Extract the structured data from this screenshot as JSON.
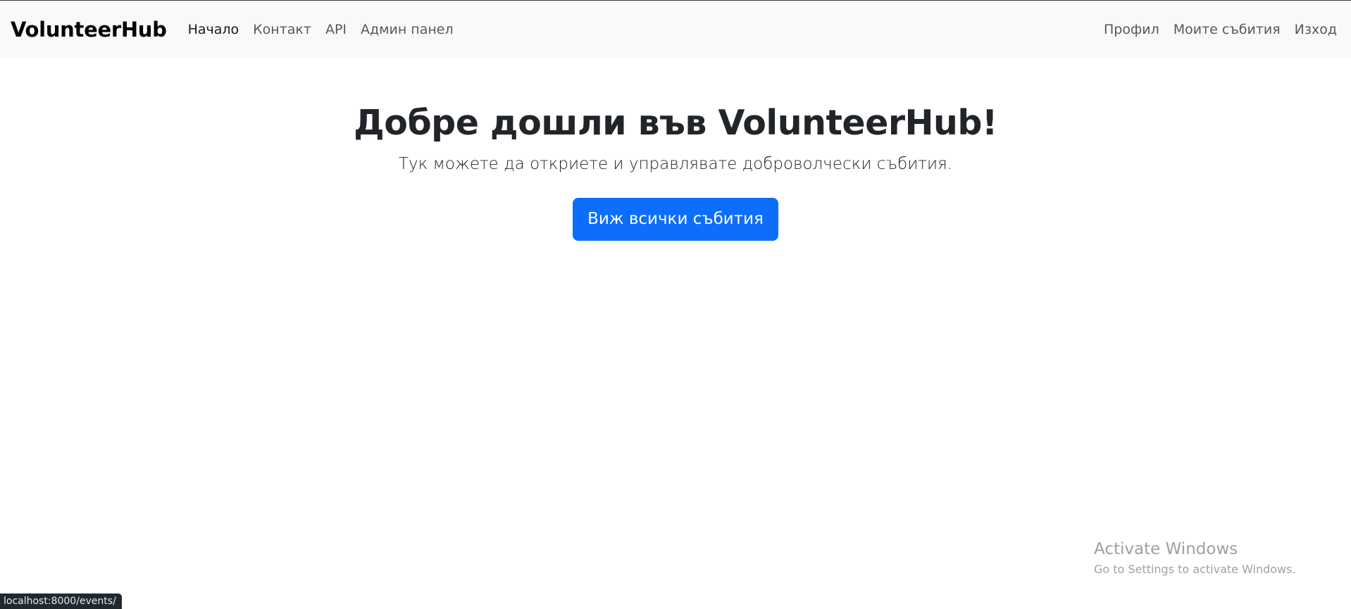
{
  "navbar": {
    "brand": "VolunteerHub",
    "left_links": [
      "Начало",
      "Контакт",
      "API",
      "Админ панел"
    ],
    "right_links": [
      "Профил",
      "Моите събития",
      "Изход"
    ]
  },
  "hero": {
    "title": "Добре дошли във VolunteerHub!",
    "subtitle": "Тук можете да откриете и управлявате доброволчески събития.",
    "button_label": "Виж всички събития"
  },
  "watermark": {
    "title": "Activate Windows",
    "subtitle": "Go to Settings to activate Windows."
  },
  "status_bar": {
    "url": "localhost:8000/events/"
  },
  "colors": {
    "navbar_bg": "#f8f9fa",
    "primary": "#0d6efd",
    "text": "#212529"
  }
}
